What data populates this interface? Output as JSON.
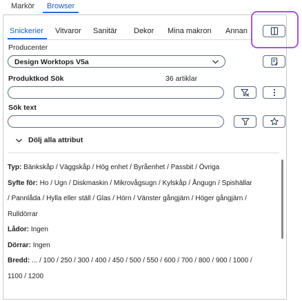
{
  "top_tabs": [
    "Markör",
    "Browser"
  ],
  "category_tabs": [
    "Snickerier",
    "Vitvaror",
    "Sanitär",
    "Dekor",
    "Mina makron",
    "Annan"
  ],
  "producer": {
    "label": "Producenter",
    "selected": "Design Worktops V5a"
  },
  "product_code": {
    "label": "Produktkod Sök",
    "count": "36 artiklar",
    "value": ""
  },
  "search_text": {
    "label": "Sök text",
    "value": ""
  },
  "hide_attributes_label": "Dölj alla attribut",
  "attributes": [
    {
      "key": "Typ:",
      "text": "Bänkskåp / Väggskåp / Hög enhet / Byråenhet / Passbit / Övriga"
    },
    {
      "key": "Syfte för:",
      "text": "Ho / Ugn / Diskmaskin / Mikrovågsugn / Kylskåp / Ångugn / Spishällar / Pannlåda / Hylla eller ställ / Glas / Hörn / Vänster gångjärn / Höger gångjärn / Rulldörrar"
    },
    {
      "key": "Lådor:",
      "text": "Ingen"
    },
    {
      "key": "Dörrar:",
      "text": "Ingen"
    },
    {
      "key": "Bredd:",
      "text": "... / 100 / 250 / 300 / 400 / 450 / 500 / 550 / 600 / 700 / 800 / 900 / 1000 / 1100 / 1200"
    }
  ],
  "icons": {
    "view_toggle": "panel-toggle-icon",
    "producer_action": "document-edit-icon",
    "filter_clear": "filter-clear-icon",
    "more": "more-vertical-icon",
    "filter": "filter-icon",
    "favorite": "star-icon",
    "hide_toggle": "chevron-down-icon",
    "select_chevron": "chevron-down-icon"
  },
  "colors": {
    "accent": "#2a6ad8",
    "highlight": "#a855d8"
  }
}
